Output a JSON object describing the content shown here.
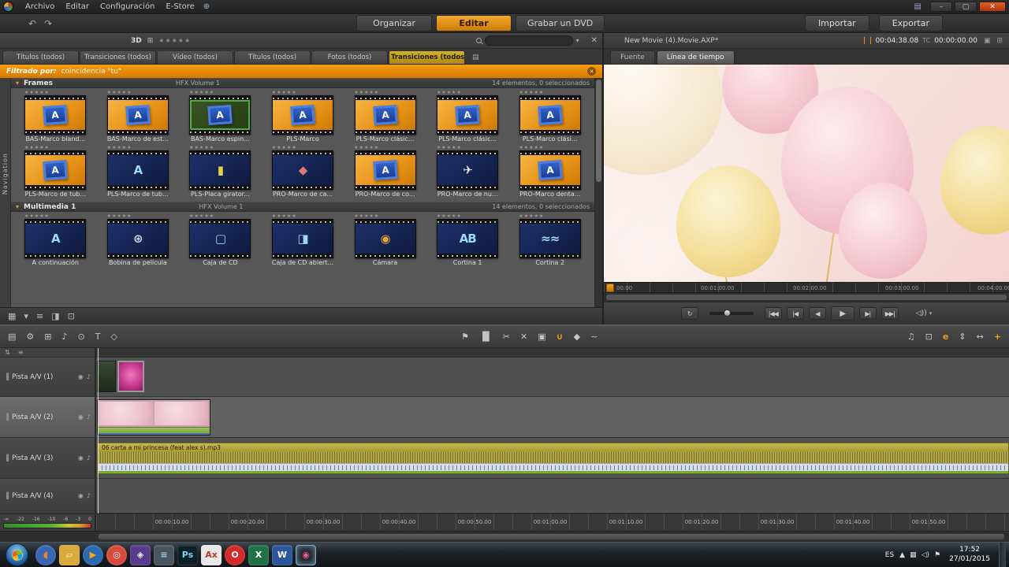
{
  "window": {
    "controls": [
      {
        "name": "minimize",
        "glyph": "–"
      },
      {
        "name": "restore",
        "glyph": "▢"
      },
      {
        "name": "close",
        "glyph": "✕"
      }
    ]
  },
  "icons": {
    "close": "✕",
    "dropdown": "▾",
    "lock": "⇅",
    "menu": "≡",
    "panel": "▣",
    "grip": "▐",
    "video": "◉",
    "audio": "♪",
    "globe": "⊕",
    "film": "▤",
    "grid": "⊞"
  },
  "menu_bar": {
    "menus": [
      "Archivo",
      "Editar",
      "Configuración",
      "E-Store"
    ]
  },
  "mode_bar": {
    "undo": "↶",
    "redo": "↷",
    "tabs": [
      {
        "label": "Organizar",
        "active": false
      },
      {
        "label": "Editar",
        "active": true
      },
      {
        "label": "Grabar un DVD",
        "active": false
      }
    ],
    "import_label": "Importar",
    "export_label": "Exportar"
  },
  "library": {
    "header": {
      "view_3d_label": "3D",
      "rating": "★★★★★"
    },
    "tabs": [
      {
        "label": "Títulos (todos)",
        "active": false
      },
      {
        "label": "Transiciones (todos)",
        "active": false
      },
      {
        "label": "Vídeo (todos)",
        "active": false
      },
      {
        "label": "Títulos (todos)",
        "active": false
      },
      {
        "label": "Fotos (todos)",
        "active": false
      },
      {
        "label": "Transiciones (todos)",
        "active": true
      }
    ],
    "filter": {
      "label": "Filtrado por:",
      "value": "coincidencia \"tu\""
    },
    "nav_label": "Navigation",
    "item_rating": "★★★★★",
    "sections": [
      {
        "title": "Frames",
        "subtitle": "HFX Volume 1",
        "count": "14 elementos, 0 seleccionados",
        "items": [
          {
            "name": "BAS-Marco bland...",
            "variant": "orange",
            "glyph": "A"
          },
          {
            "name": "BAS-Marco de est...",
            "variant": "orange",
            "glyph": "A"
          },
          {
            "name": "BAS-Marco espin...",
            "variant": "green",
            "glyph": "A"
          },
          {
            "name": "PLS-Marco",
            "variant": "orange",
            "glyph": "A"
          },
          {
            "name": "PLS-Marco clásic...",
            "variant": "orange",
            "glyph": "A"
          },
          {
            "name": "PLS-Marco clásic...",
            "variant": "orange",
            "glyph": "A"
          },
          {
            "name": "PLS-Marco clási...",
            "variant": "orange",
            "glyph": "A"
          },
          {
            "name": "PLS-Marco de tub...",
            "variant": "orange",
            "glyph": "A"
          },
          {
            "name": "PLS-Marco de tub...",
            "variant": "dark",
            "glyph": "A"
          },
          {
            "name": "PLS-Placa girator...",
            "variant": "dark",
            "glyph": "▮",
            "fg": "#e8d44c"
          },
          {
            "name": "PRO-Marco de ca...",
            "variant": "dark",
            "glyph": "◆",
            "fg": "#d87a7a"
          },
          {
            "name": "PRO-Marco de co...",
            "variant": "orange",
            "glyph": "A"
          },
          {
            "name": "PRO-Marco de nu...",
            "variant": "dark",
            "glyph": "✈",
            "fg": "#e8e8e8"
          },
          {
            "name": "PRO-Marco denta...",
            "variant": "orange",
            "glyph": "A"
          }
        ]
      },
      {
        "title": "Multimedia 1",
        "subtitle": "HFX Volume 1",
        "count": "14 elementos, 0 seleccionados",
        "items": [
          {
            "name": "A continuación",
            "variant": "dark",
            "glyph": "A"
          },
          {
            "name": "Bobina de película",
            "variant": "dark",
            "glyph": "⊛",
            "fg": "#cfd6dd"
          },
          {
            "name": "Caja de CD",
            "variant": "dark",
            "glyph": "▢",
            "fg": "#9fd8f2"
          },
          {
            "name": "Caja de CD abiert...",
            "variant": "dark",
            "glyph": "◨",
            "fg": "#9fd8f2"
          },
          {
            "name": "Cámara",
            "variant": "dark",
            "glyph": "◉",
            "fg": "#e8a03c"
          },
          {
            "name": "Cortina 1",
            "variant": "dark",
            "glyph": "AB",
            "fg": "#9fd8f2"
          },
          {
            "name": "Cortina 2",
            "variant": "dark",
            "glyph": "≈≈",
            "fg": "#9fd8f2"
          }
        ]
      }
    ],
    "footer_icons": [
      {
        "name": "thumbnail-view-icon",
        "glyph": "▦"
      },
      {
        "name": "view-options-icon",
        "glyph": "▾"
      },
      {
        "name": "list-view-icon",
        "glyph": "≡"
      },
      {
        "name": "info-pane-icon",
        "glyph": "◨"
      },
      {
        "name": "player-preview-icon",
        "glyph": "⊡"
      }
    ]
  },
  "preview": {
    "title": "New Movie (4).Movie.AXP*",
    "duration": "00:04:38.08",
    "tc_label": "TC",
    "timecode": "00:00:00.00",
    "tabs": [
      {
        "label": "Fuente",
        "active": false
      },
      {
        "label": "Línea de tiempo",
        "active": true
      }
    ],
    "ruler_ticks": [
      "00:00",
      "00:01:00.00",
      "00:02:00.00",
      "00:03:00.00",
      "00:04:00.00"
    ],
    "transport": {
      "loop": "↻",
      "buttons": [
        {
          "name": "go-to-start-button",
          "glyph": "|◀◀"
        },
        {
          "name": "previous-frame-button",
          "glyph": "|◀"
        },
        {
          "name": "play-reverse-button",
          "glyph": "◀"
        },
        {
          "name": "play-button",
          "glyph": "▶",
          "big": true
        },
        {
          "name": "next-frame-button",
          "glyph": "▶|"
        },
        {
          "name": "go-to-end-button",
          "glyph": "▶▶|"
        }
      ],
      "volume": "◁))"
    }
  },
  "timeline": {
    "toolbar_left": [
      {
        "name": "storyboard-toggle-icon",
        "glyph": "▤"
      },
      {
        "name": "settings-icon",
        "glyph": "⚙"
      },
      {
        "name": "split-view-icon",
        "glyph": "⊞"
      },
      {
        "name": "audio-mixer-icon",
        "glyph": "♪"
      },
      {
        "name": "voiceover-icon",
        "glyph": "⊙"
      },
      {
        "name": "title-editor-icon",
        "glyph": "T"
      },
      {
        "name": "pip-icon",
        "glyph": "◇"
      }
    ],
    "toolbar_mid": [
      {
        "name": "marker-icon",
        "glyph": "⚑"
      },
      {
        "name": "trim-mode-icon",
        "glyph": "▐▌"
      },
      {
        "name": "razor-icon",
        "glyph": "✂"
      },
      {
        "name": "delete-clip-icon",
        "glyph": "✕"
      },
      {
        "name": "snapshot-icon",
        "glyph": "▣"
      },
      {
        "name": "magnet-icon",
        "glyph": "∪",
        "accent": true
      },
      {
        "name": "keyframe-icon",
        "glyph": "◆"
      },
      {
        "name": "volume-keyframe-icon",
        "glyph": "~"
      }
    ],
    "toolbar_right": [
      {
        "name": "audio-scrub-icon",
        "glyph": "♫"
      },
      {
        "name": "preview-mode-icon",
        "glyph": "⊡"
      },
      {
        "name": "editor-mode-icon",
        "glyph": "e",
        "accent": true
      },
      {
        "name": "track-size-icon",
        "glyph": "⇕"
      },
      {
        "name": "zoom-fit-icon",
        "glyph": "↔"
      },
      {
        "name": "zoom-in-icon",
        "glyph": "+",
        "accent": true
      }
    ],
    "substrip": {
      "left_icon": "⇅",
      "right_icon": "≡"
    },
    "tracks": [
      {
        "name": "Pista A/V (1)",
        "selected": false
      },
      {
        "name": "Pista A/V (2)",
        "selected": true
      },
      {
        "name": "Pista A/V (3)",
        "selected": false
      },
      {
        "name": "Pista A/V (4)",
        "selected": false
      }
    ],
    "audio_clip_label": "06 carta a mi princesa (feat alex s).mp3",
    "ruler_ticks": [
      "00:00:10.00",
      "00:00:20.00",
      "00:00:30.00",
      "00:00:40.00",
      "00:00:50.00",
      "00:01:00.00",
      "00:01:10.00",
      "00:01:20.00",
      "00:01:30.00",
      "00:01:40.00",
      "00:01:50.00"
    ],
    "meter_scale": [
      "-∞",
      "-22",
      "-16",
      "-10",
      "-6",
      "-3",
      "0"
    ]
  },
  "taskbar": {
    "language": "ES",
    "time": "17:52",
    "date": "27/01/2015",
    "tray_icons": [
      {
        "name": "show-hidden-icons",
        "glyph": "▲"
      },
      {
        "name": "network-icon",
        "glyph": "▦"
      },
      {
        "name": "volume-tray-icon",
        "glyph": "◁)"
      },
      {
        "name": "action-center-icon",
        "glyph": "⚑"
      }
    ],
    "apps": [
      {
        "name": "firefox-icon",
        "shape": "circle",
        "bg": "#3a66b0",
        "fg": "#f08a2a",
        "glyph": "◖"
      },
      {
        "name": "explorer-icon",
        "shape": "square",
        "bg": "#d9a93a",
        "fg": "#fff8e0",
        "glyph": "▱"
      },
      {
        "name": "media-player-icon",
        "shape": "circle",
        "bg": "#2a6ab0",
        "fg": "#ffa31a",
        "glyph": "▶"
      },
      {
        "name": "chrome-icon",
        "shape": "circle",
        "bg": "#d94b3c",
        "fg": "#e8f0f8",
        "glyph": "◎"
      },
      {
        "name": "pinnacle-hub-icon",
        "shape": "square",
        "bg": "#5a3a8a",
        "fg": "#ffffff",
        "glyph": "◈"
      },
      {
        "name": "capture-device-icon",
        "shape": "square",
        "bg": "#4a5560",
        "fg": "#9fd0e8",
        "glyph": "≡"
      },
      {
        "name": "photoshop-icon",
        "shape": "square",
        "bg": "#0b2026",
        "fg": "#7fd3f7",
        "glyph": "Ps"
      },
      {
        "name": "axure-icon",
        "shape": "square",
        "bg": "#e8e8e8",
        "fg": "#c0392b",
        "glyph": "Ax"
      },
      {
        "name": "opera-icon",
        "shape": "circle",
        "bg": "#d42a2a",
        "fg": "#ffffff",
        "glyph": "O"
      },
      {
        "name": "excel-icon",
        "shape": "square",
        "bg": "#1f7246",
        "fg": "#ffffff",
        "glyph": "X"
      },
      {
        "name": "word-icon",
        "shape": "square",
        "bg": "#2b579a",
        "fg": "#ffffff",
        "glyph": "W"
      },
      {
        "name": "pinnacle-studio-icon",
        "shape": "square",
        "bg": "#23262b",
        "fg": "#e85d9a",
        "glyph": "◉",
        "active": true
      }
    ]
  }
}
